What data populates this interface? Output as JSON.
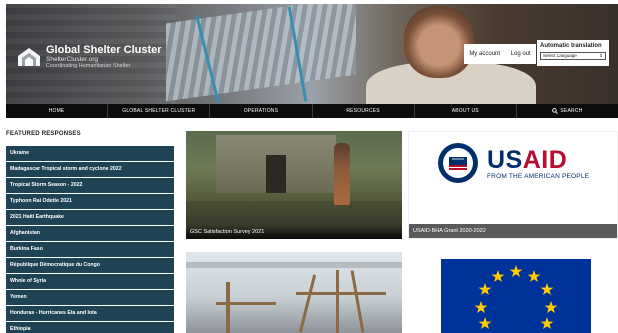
{
  "header": {
    "logo_title": "Global Shelter Cluster",
    "logo_site": "ShelterCluster.org",
    "logo_tagline": "Coordinating Humanitarian Shelter",
    "my_account": "My account",
    "log_out": "Log out",
    "translate_label": "Automatic translation",
    "translate_select": "Select Language"
  },
  "nav": {
    "items": [
      "HOME",
      "GLOBAL SHELTER CLUSTER",
      "OPERATIONS",
      "RESOURCES",
      "ABOUT US",
      "SEARCH"
    ]
  },
  "sidebar": {
    "title": "FEATURED RESPONSES",
    "items": [
      "Ukraine",
      "Madagascar Tropical storm and cyclone 2022",
      "Tropical Storm Season - 2022",
      "Typhoon Rai Odette 2021",
      "2021 Haiti Earthquake",
      "Afghanistan",
      "Burkina Faso",
      "République Démocratique du Congo",
      "Whole of Syria",
      "Yemen",
      "Honduras - Hurricanes Eta and Iota",
      "Ethiopia"
    ]
  },
  "cards": {
    "c1_caption": "GSC Satisfaction Survey 2021",
    "c2_caption": "USAID-BHA Grant 2020-2022",
    "usaid_us": "US",
    "usaid_aid": "AID",
    "usaid_sub": "FROM THE AMERICAN PEOPLE"
  },
  "colors": {
    "sidebar_bg": "#1d4355",
    "nav_bg": "#0c0c0c",
    "usaid_blue": "#002f6c",
    "usaid_red": "#ba0c2f",
    "eu_blue": "#003399",
    "eu_gold": "#ffcc00"
  }
}
